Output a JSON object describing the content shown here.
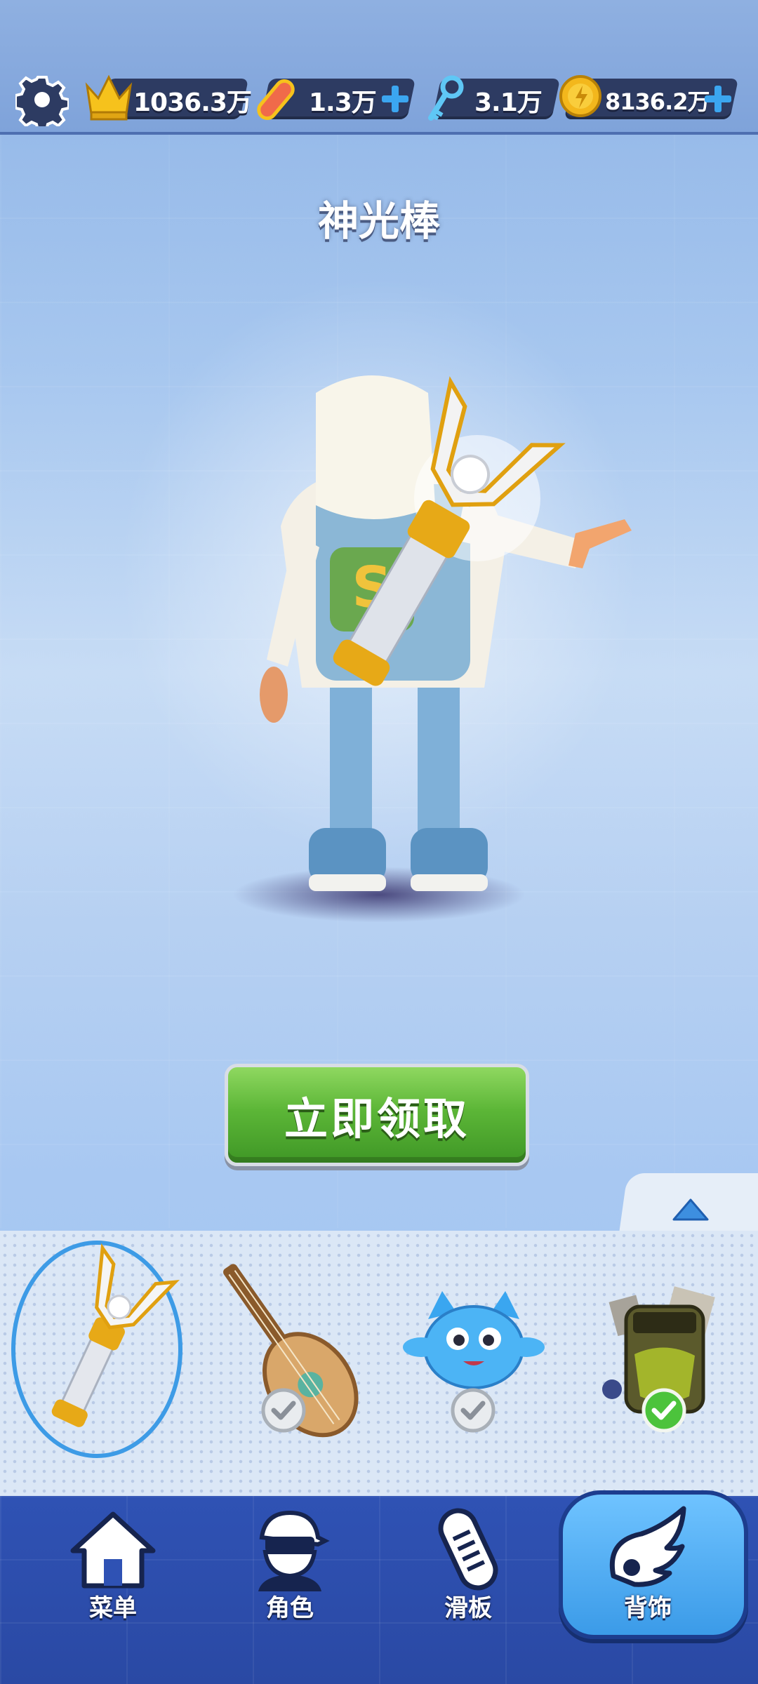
{
  "topbar": {
    "settings_icon": "gear-icon",
    "stats": [
      {
        "name": "score",
        "icon": "crown-icon",
        "value": "1036.3万",
        "has_plus": false
      },
      {
        "name": "hoverboards",
        "icon": "hoverboard-icon",
        "value": "1.3万",
        "has_plus": true
      },
      {
        "name": "keys",
        "icon": "key-icon",
        "value": "3.1万",
        "has_plus": false
      },
      {
        "name": "coins",
        "icon": "coin-icon",
        "value": "8136.2万",
        "has_plus": true
      }
    ]
  },
  "title": "神光棒",
  "claim_button": {
    "label": "立即领取"
  },
  "tray": {
    "items": [
      {
        "name": "light-wand",
        "selected": true,
        "owned_state": "none"
      },
      {
        "name": "pipa-lute",
        "selected": false,
        "owned_state": "owned"
      },
      {
        "name": "blue-pet",
        "selected": false,
        "owned_state": "owned"
      },
      {
        "name": "graffiti-backpack",
        "selected": false,
        "owned_state": "equipped"
      }
    ]
  },
  "nav": {
    "items": [
      {
        "label": "菜单",
        "icon": "home-icon"
      },
      {
        "label": "角色",
        "icon": "character-icon"
      },
      {
        "label": "滑板",
        "icon": "skateboard-icon"
      },
      {
        "label": "背饰",
        "icon": "wings-icon",
        "active": true
      }
    ]
  },
  "colors": {
    "accent_green": "#5cb637",
    "selection_blue": "#3d9be6",
    "nav_blue": "#2f52b4",
    "coin_gold": "#f3b71c"
  }
}
